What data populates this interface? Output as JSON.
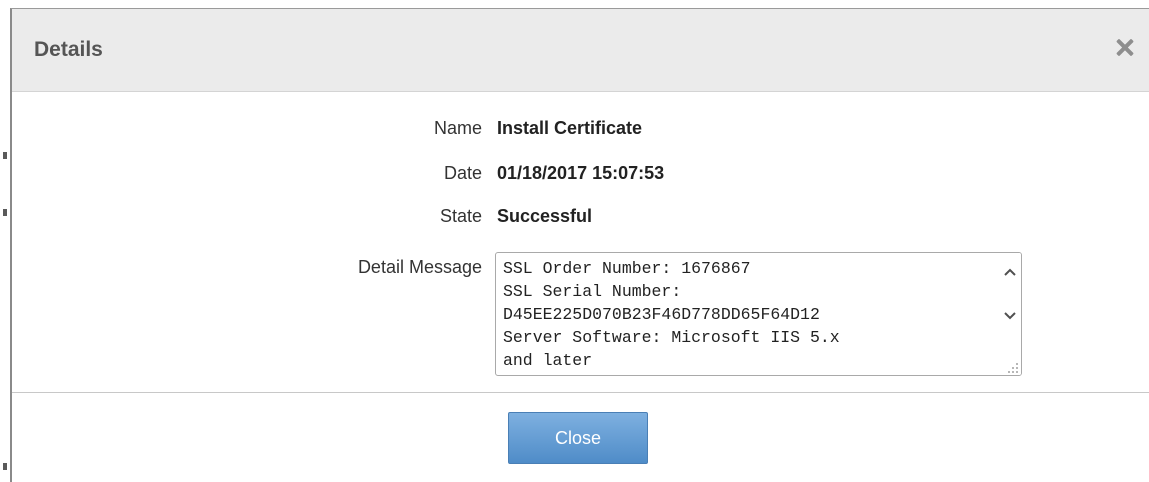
{
  "dialog": {
    "title": "Details",
    "close_icon": "close-icon"
  },
  "fields": {
    "name_label": "Name",
    "name_value": "Install Certificate",
    "date_label": "Date",
    "date_value": "01/18/2017 15:07:53",
    "state_label": "State",
    "state_value": "Successful",
    "detail_label": "Detail Message",
    "detail_value": "SSL Order Number: 1676867\nSSL Serial Number:\nD45EE225D070B23F46D778DD65F64D12\nServer Software: Microsoft IIS 5.x\nand later"
  },
  "footer": {
    "close_label": "Close"
  },
  "colors": {
    "header_bg": "#ebebeb",
    "button_top": "#7eb0e0",
    "button_bottom": "#4f8cc8"
  }
}
